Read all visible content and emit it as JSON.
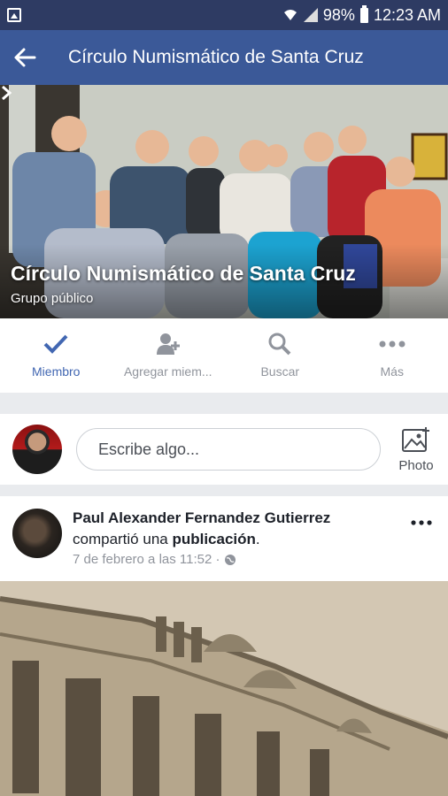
{
  "status_bar": {
    "battery": "98%",
    "time": "12:23 AM"
  },
  "app_bar": {
    "title": "Círculo Numismático de Santa Cruz"
  },
  "cover": {
    "title": "Círculo Numismático de Santa Cruz",
    "subtitle": "Grupo público"
  },
  "actions": [
    {
      "label": "Miembro",
      "icon": "check-icon",
      "active": true
    },
    {
      "label": "Agregar miem...",
      "icon": "add-person-icon",
      "active": false
    },
    {
      "label": "Buscar",
      "icon": "search-icon",
      "active": false
    },
    {
      "label": "Más",
      "icon": "more-icon",
      "active": false
    }
  ],
  "composer": {
    "placeholder": "Escribe algo...",
    "photo_label": "Photo"
  },
  "post": {
    "author": "Paul Alexander Fernandez Gutierrez",
    "action_prefix": "compartió una ",
    "action_object": "publicación",
    "action_suffix": ".",
    "timestamp": "7 de febrero a las 11:52 ·"
  },
  "colors": {
    "brand": "#3b5998",
    "accent": "#4267b2",
    "status_bar": "#2e3b63"
  }
}
